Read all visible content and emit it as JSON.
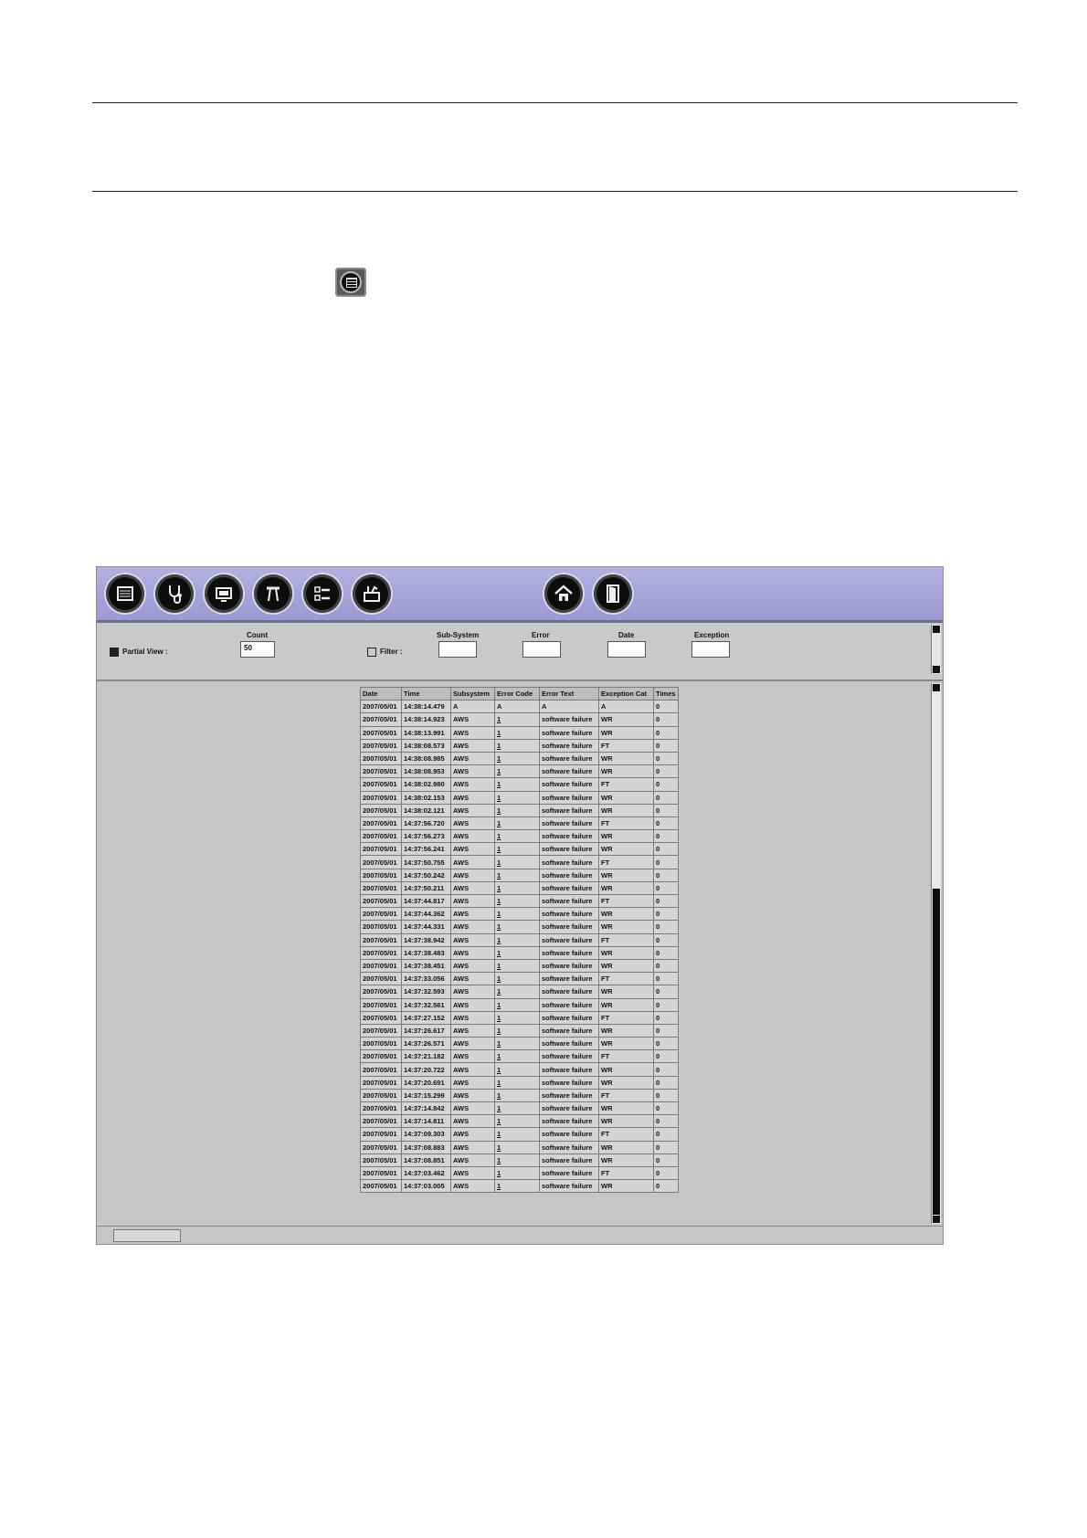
{
  "toolbar": {
    "buttons": [
      {
        "icon": "list-view-icon"
      },
      {
        "icon": "stethoscope-icon"
      },
      {
        "icon": "monitor-icon"
      },
      {
        "icon": "caliper-icon"
      },
      {
        "icon": "checklist-icon"
      },
      {
        "icon": "toolbox-icon"
      },
      {
        "icon": "home-icon"
      },
      {
        "icon": "exit-door-icon"
      }
    ]
  },
  "filters": {
    "partial_view_label": "Partial View :",
    "partial_view_checked": true,
    "count_label": "Count",
    "count_value": "50",
    "filter_label": "Filter :",
    "filter_checked": false,
    "subsystem_label": "Sub-System",
    "error_label": "Error",
    "date_label": "Date",
    "exception_label": "Exception"
  },
  "table": {
    "headers": [
      "Date",
      "Time",
      "Subsystem",
      "Error Code",
      "Error Text",
      "Exception Cat",
      "Times"
    ],
    "rows": [
      [
        "2007/05/01",
        "14:38:14.479",
        "A",
        "A",
        "A",
        "A",
        "0"
      ],
      [
        "2007/05/01",
        "14:38:14.923",
        "AWS",
        "1",
        "software failure",
        "WR",
        "0"
      ],
      [
        "2007/05/01",
        "14:38:13.991",
        "AWS",
        "1",
        "software failure",
        "WR",
        "0"
      ],
      [
        "2007/05/01",
        "14:38:08.573",
        "AWS",
        "1",
        "software failure",
        "FT",
        "0"
      ],
      [
        "2007/05/01",
        "14:38:08.985",
        "AWS",
        "1",
        "software failure",
        "WR",
        "0"
      ],
      [
        "2007/05/01",
        "14:38:08.953",
        "AWS",
        "1",
        "software failure",
        "WR",
        "0"
      ],
      [
        "2007/05/01",
        "14:38:02.980",
        "AWS",
        "1",
        "software failure",
        "FT",
        "0"
      ],
      [
        "2007/05/01",
        "14:38:02.153",
        "AWS",
        "1",
        "software failure",
        "WR",
        "0"
      ],
      [
        "2007/05/01",
        "14:38:02.121",
        "AWS",
        "1",
        "software failure",
        "WR",
        "0"
      ],
      [
        "2007/05/01",
        "14:37:56.720",
        "AWS",
        "1",
        "software failure",
        "FT",
        "0"
      ],
      [
        "2007/05/01",
        "14:37:56.273",
        "AWS",
        "1",
        "software failure",
        "WR",
        "0"
      ],
      [
        "2007/05/01",
        "14:37:56.241",
        "AWS",
        "1",
        "software failure",
        "WR",
        "0"
      ],
      [
        "2007/05/01",
        "14:37:50.755",
        "AWS",
        "1",
        "software failure",
        "FT",
        "0"
      ],
      [
        "2007/05/01",
        "14:37:50.242",
        "AWS",
        "1",
        "software failure",
        "WR",
        "0"
      ],
      [
        "2007/05/01",
        "14:37:50.211",
        "AWS",
        "1",
        "software failure",
        "WR",
        "0"
      ],
      [
        "2007/05/01",
        "14:37:44.817",
        "AWS",
        "1",
        "software failure",
        "FT",
        "0"
      ],
      [
        "2007/05/01",
        "14:37:44.362",
        "AWS",
        "1",
        "software failure",
        "WR",
        "0"
      ],
      [
        "2007/05/01",
        "14:37:44.331",
        "AWS",
        "1",
        "software failure",
        "WR",
        "0"
      ],
      [
        "2007/05/01",
        "14:37:38.942",
        "AWS",
        "1",
        "software failure",
        "FT",
        "0"
      ],
      [
        "2007/05/01",
        "14:37:38.483",
        "AWS",
        "1",
        "software failure",
        "WR",
        "0"
      ],
      [
        "2007/05/01",
        "14:37:38.451",
        "AWS",
        "1",
        "software failure",
        "WR",
        "0"
      ],
      [
        "2007/05/01",
        "14:37:33.056",
        "AWS",
        "1",
        "software failure",
        "FT",
        "0"
      ],
      [
        "2007/05/01",
        "14:37:32.593",
        "AWS",
        "1",
        "software failure",
        "WR",
        "0"
      ],
      [
        "2007/05/01",
        "14:37:32.561",
        "AWS",
        "1",
        "software failure",
        "WR",
        "0"
      ],
      [
        "2007/05/01",
        "14:37:27.152",
        "AWS",
        "1",
        "software failure",
        "FT",
        "0"
      ],
      [
        "2007/05/01",
        "14:37:26.617",
        "AWS",
        "1",
        "software failure",
        "WR",
        "0"
      ],
      [
        "2007/05/01",
        "14:37:26.571",
        "AWS",
        "1",
        "software failure",
        "WR",
        "0"
      ],
      [
        "2007/05/01",
        "14:37:21.182",
        "AWS",
        "1",
        "software failure",
        "FT",
        "0"
      ],
      [
        "2007/05/01",
        "14:37:20.722",
        "AWS",
        "1",
        "software failure",
        "WR",
        "0"
      ],
      [
        "2007/05/01",
        "14:37:20.691",
        "AWS",
        "1",
        "software failure",
        "WR",
        "0"
      ],
      [
        "2007/05/01",
        "14:37:15.299",
        "AWS",
        "1",
        "software failure",
        "FT",
        "0"
      ],
      [
        "2007/05/01",
        "14:37:14.842",
        "AWS",
        "1",
        "software failure",
        "WR",
        "0"
      ],
      [
        "2007/05/01",
        "14:37:14.811",
        "AWS",
        "1",
        "software failure",
        "WR",
        "0"
      ],
      [
        "2007/05/01",
        "14:37:09.303",
        "AWS",
        "1",
        "software failure",
        "FT",
        "0"
      ],
      [
        "2007/05/01",
        "14:37:08.883",
        "AWS",
        "1",
        "software failure",
        "WR",
        "0"
      ],
      [
        "2007/05/01",
        "14:37:08.851",
        "AWS",
        "1",
        "software failure",
        "WR",
        "0"
      ],
      [
        "2007/05/01",
        "14:37:03.462",
        "AWS",
        "1",
        "software failure",
        "FT",
        "0"
      ],
      [
        "2007/05/01",
        "14:37:03.005",
        "AWS",
        "1",
        "software failure",
        "WR",
        "0"
      ]
    ]
  }
}
